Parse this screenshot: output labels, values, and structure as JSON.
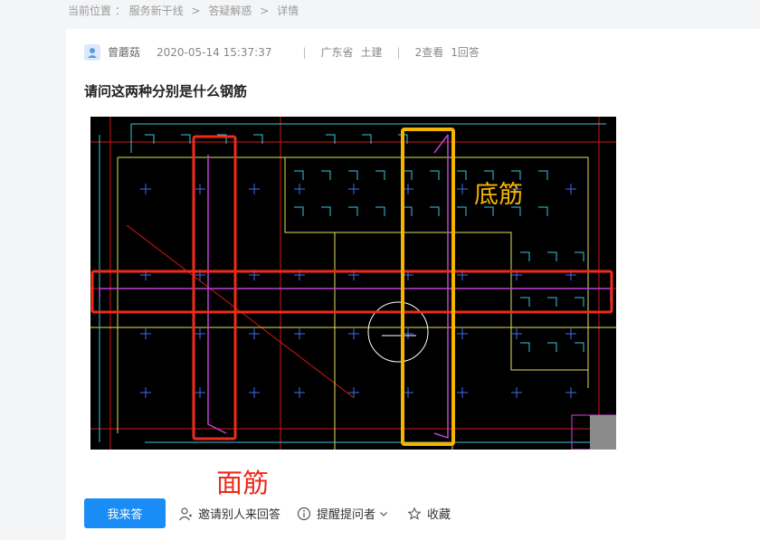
{
  "breadcrumb": {
    "prefix": "当前位置 ：",
    "items": [
      "服务新干线",
      "答疑解惑",
      "详情"
    ],
    "separator": ">"
  },
  "question": {
    "author": "曾蘑菇",
    "datetime": "2020-05-14 15:37:37",
    "region": "广东省",
    "category": "土建",
    "views": "2查看",
    "answers": "1回答",
    "title": "请问这两种分别是什么钢筋"
  },
  "annotations": {
    "bottom_rebar": "底筋",
    "top_rebar": "面筋"
  },
  "actions": {
    "answer": "我来答",
    "invite": "邀请别人来回答",
    "remind": "提醒提问者",
    "favorite": "收藏"
  },
  "colors": {
    "primary": "#1a8cf5",
    "highlight_red": "#f02a1a",
    "highlight_yellow": "#f5b400"
  }
}
